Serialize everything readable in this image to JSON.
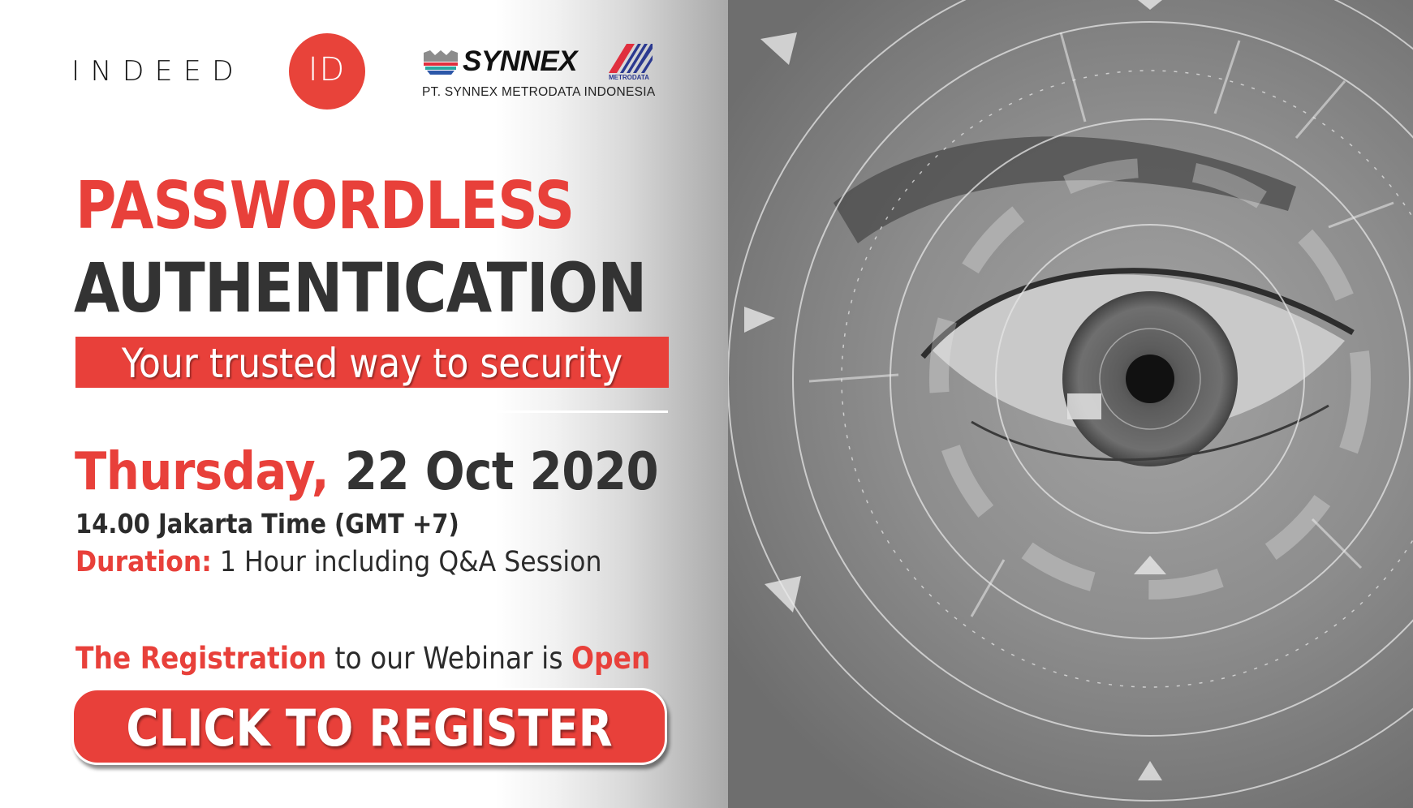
{
  "banner": {
    "logos": {
      "indeed_id": {
        "word": "INDEED",
        "badge": "ID",
        "badge_color": "#e8433a"
      },
      "synnex": {
        "word": "SYNNEX",
        "company_line": "PT. SYNNEX METRODATA INDONESIA"
      },
      "metrodata": {
        "word": "METRODATA",
        "colors": {
          "red": "#e02f3e",
          "blue": "#2b3990"
        }
      }
    },
    "headline": {
      "line1": "PASSWORDLESS",
      "line2": "AUTHENTICATION"
    },
    "tagline": "Your trusted way to security",
    "event": {
      "day": "Thursday,",
      "date": " 22 Oct 2020",
      "time": "14.00 Jakarta Time  (GMT +7)",
      "duration_label": "Duration:",
      "duration_value": " 1 Hour including Q&A Session"
    },
    "registration": {
      "part1": "The Registration",
      "part2": " to our Webinar is ",
      "part3": "Open"
    },
    "cta": {
      "label": "CLICK TO REGISTER"
    },
    "image": {
      "description": "close-up of a human eye with futuristic biometric scanning rings overlay (grayscale)"
    },
    "colors": {
      "accent": "#e8403a",
      "text_dark": "#333333"
    }
  }
}
